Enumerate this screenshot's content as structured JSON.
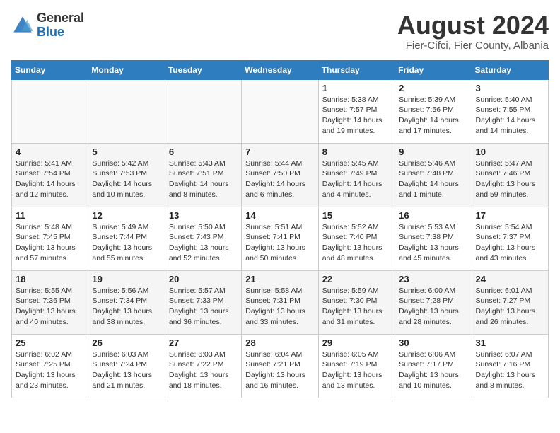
{
  "logo": {
    "general": "General",
    "blue": "Blue"
  },
  "title": "August 2024",
  "subtitle": "Fier-Cifci, Fier County, Albania",
  "calendar": {
    "headers": [
      "Sunday",
      "Monday",
      "Tuesday",
      "Wednesday",
      "Thursday",
      "Friday",
      "Saturday"
    ],
    "weeks": [
      [
        {
          "day": "",
          "info": ""
        },
        {
          "day": "",
          "info": ""
        },
        {
          "day": "",
          "info": ""
        },
        {
          "day": "",
          "info": ""
        },
        {
          "day": "1",
          "info": "Sunrise: 5:38 AM\nSunset: 7:57 PM\nDaylight: 14 hours\nand 19 minutes."
        },
        {
          "day": "2",
          "info": "Sunrise: 5:39 AM\nSunset: 7:56 PM\nDaylight: 14 hours\nand 17 minutes."
        },
        {
          "day": "3",
          "info": "Sunrise: 5:40 AM\nSunset: 7:55 PM\nDaylight: 14 hours\nand 14 minutes."
        }
      ],
      [
        {
          "day": "4",
          "info": "Sunrise: 5:41 AM\nSunset: 7:54 PM\nDaylight: 14 hours\nand 12 minutes."
        },
        {
          "day": "5",
          "info": "Sunrise: 5:42 AM\nSunset: 7:53 PM\nDaylight: 14 hours\nand 10 minutes."
        },
        {
          "day": "6",
          "info": "Sunrise: 5:43 AM\nSunset: 7:51 PM\nDaylight: 14 hours\nand 8 minutes."
        },
        {
          "day": "7",
          "info": "Sunrise: 5:44 AM\nSunset: 7:50 PM\nDaylight: 14 hours\nand 6 minutes."
        },
        {
          "day": "8",
          "info": "Sunrise: 5:45 AM\nSunset: 7:49 PM\nDaylight: 14 hours\nand 4 minutes."
        },
        {
          "day": "9",
          "info": "Sunrise: 5:46 AM\nSunset: 7:48 PM\nDaylight: 14 hours\nand 1 minute."
        },
        {
          "day": "10",
          "info": "Sunrise: 5:47 AM\nSunset: 7:46 PM\nDaylight: 13 hours\nand 59 minutes."
        }
      ],
      [
        {
          "day": "11",
          "info": "Sunrise: 5:48 AM\nSunset: 7:45 PM\nDaylight: 13 hours\nand 57 minutes."
        },
        {
          "day": "12",
          "info": "Sunrise: 5:49 AM\nSunset: 7:44 PM\nDaylight: 13 hours\nand 55 minutes."
        },
        {
          "day": "13",
          "info": "Sunrise: 5:50 AM\nSunset: 7:43 PM\nDaylight: 13 hours\nand 52 minutes."
        },
        {
          "day": "14",
          "info": "Sunrise: 5:51 AM\nSunset: 7:41 PM\nDaylight: 13 hours\nand 50 minutes."
        },
        {
          "day": "15",
          "info": "Sunrise: 5:52 AM\nSunset: 7:40 PM\nDaylight: 13 hours\nand 48 minutes."
        },
        {
          "day": "16",
          "info": "Sunrise: 5:53 AM\nSunset: 7:38 PM\nDaylight: 13 hours\nand 45 minutes."
        },
        {
          "day": "17",
          "info": "Sunrise: 5:54 AM\nSunset: 7:37 PM\nDaylight: 13 hours\nand 43 minutes."
        }
      ],
      [
        {
          "day": "18",
          "info": "Sunrise: 5:55 AM\nSunset: 7:36 PM\nDaylight: 13 hours\nand 40 minutes."
        },
        {
          "day": "19",
          "info": "Sunrise: 5:56 AM\nSunset: 7:34 PM\nDaylight: 13 hours\nand 38 minutes."
        },
        {
          "day": "20",
          "info": "Sunrise: 5:57 AM\nSunset: 7:33 PM\nDaylight: 13 hours\nand 36 minutes."
        },
        {
          "day": "21",
          "info": "Sunrise: 5:58 AM\nSunset: 7:31 PM\nDaylight: 13 hours\nand 33 minutes."
        },
        {
          "day": "22",
          "info": "Sunrise: 5:59 AM\nSunset: 7:30 PM\nDaylight: 13 hours\nand 31 minutes."
        },
        {
          "day": "23",
          "info": "Sunrise: 6:00 AM\nSunset: 7:28 PM\nDaylight: 13 hours\nand 28 minutes."
        },
        {
          "day": "24",
          "info": "Sunrise: 6:01 AM\nSunset: 7:27 PM\nDaylight: 13 hours\nand 26 minutes."
        }
      ],
      [
        {
          "day": "25",
          "info": "Sunrise: 6:02 AM\nSunset: 7:25 PM\nDaylight: 13 hours\nand 23 minutes."
        },
        {
          "day": "26",
          "info": "Sunrise: 6:03 AM\nSunset: 7:24 PM\nDaylight: 13 hours\nand 21 minutes."
        },
        {
          "day": "27",
          "info": "Sunrise: 6:03 AM\nSunset: 7:22 PM\nDaylight: 13 hours\nand 18 minutes."
        },
        {
          "day": "28",
          "info": "Sunrise: 6:04 AM\nSunset: 7:21 PM\nDaylight: 13 hours\nand 16 minutes."
        },
        {
          "day": "29",
          "info": "Sunrise: 6:05 AM\nSunset: 7:19 PM\nDaylight: 13 hours\nand 13 minutes."
        },
        {
          "day": "30",
          "info": "Sunrise: 6:06 AM\nSunset: 7:17 PM\nDaylight: 13 hours\nand 10 minutes."
        },
        {
          "day": "31",
          "info": "Sunrise: 6:07 AM\nSunset: 7:16 PM\nDaylight: 13 hours\nand 8 minutes."
        }
      ]
    ]
  }
}
